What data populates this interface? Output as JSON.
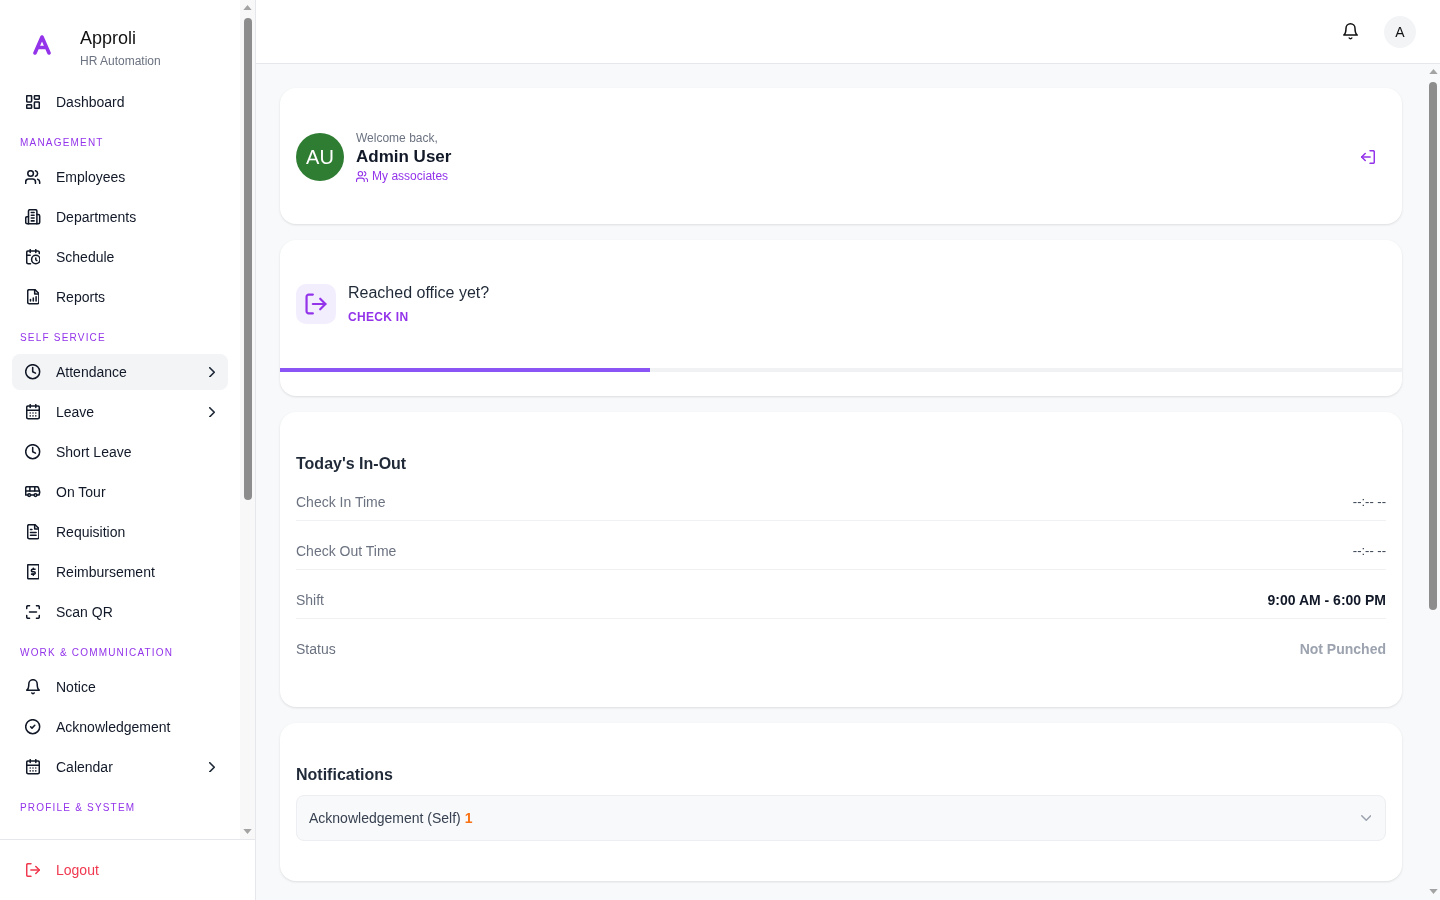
{
  "sidebar": {
    "brand": {
      "name": "Approli",
      "tagline": "HR Automation"
    },
    "sections": [
      {
        "items": [
          {
            "label": "Dashboard",
            "selected": false,
            "expandable": false
          }
        ]
      },
      {
        "title": "MANAGEMENT",
        "items": [
          {
            "label": "Employees",
            "selected": false,
            "expandable": false
          },
          {
            "label": "Departments",
            "selected": false,
            "expandable": false
          },
          {
            "label": "Schedule",
            "selected": false,
            "expandable": false
          },
          {
            "label": "Reports",
            "selected": false,
            "expandable": false
          }
        ]
      },
      {
        "title": "SELF SERVICE",
        "items": [
          {
            "label": "Attendance",
            "selected": true,
            "expandable": true
          },
          {
            "label": "Leave",
            "selected": false,
            "expandable": true
          },
          {
            "label": "Short Leave",
            "selected": false,
            "expandable": false
          },
          {
            "label": "On Tour",
            "selected": false,
            "expandable": false
          },
          {
            "label": "Requisition",
            "selected": false,
            "expandable": false
          },
          {
            "label": "Reimbursement",
            "selected": false,
            "expandable": false
          },
          {
            "label": "Scan QR",
            "selected": false,
            "expandable": false
          }
        ]
      },
      {
        "title": "WORK & COMMUNICATION",
        "items": [
          {
            "label": "Notice",
            "selected": false,
            "expandable": false
          },
          {
            "label": "Acknowledgement",
            "selected": false,
            "expandable": false
          },
          {
            "label": "Calendar",
            "selected": false,
            "expandable": true
          }
        ]
      },
      {
        "title": "PROFILE & SYSTEM"
      }
    ],
    "logout": "Logout"
  },
  "header": {
    "avatar": "A"
  },
  "welcome": {
    "initials": "AU",
    "greeting": "Welcome back,",
    "name": "Admin User",
    "link": "My associates"
  },
  "check_in": {
    "question": "Reached office yet?",
    "action": "CHECK IN",
    "level": 0.33
  },
  "in_out": {
    "title": "Today's In-Out",
    "rows": [
      {
        "label": "Check In Time",
        "value": "--:-- --",
        "kind": "time"
      },
      {
        "label": "Check Out Time",
        "value": "--:-- --",
        "kind": "time"
      },
      {
        "label": "Shift",
        "value": "9:00 AM - 6:00 PM",
        "kind": "shift"
      },
      {
        "label": "Status",
        "value": "Not Punched",
        "kind": "status"
      }
    ]
  },
  "notifications": {
    "title": "Notifications",
    "items": [
      {
        "label": "Acknowledgement (Self)",
        "count": "1",
        "expanded": false
      }
    ]
  }
}
